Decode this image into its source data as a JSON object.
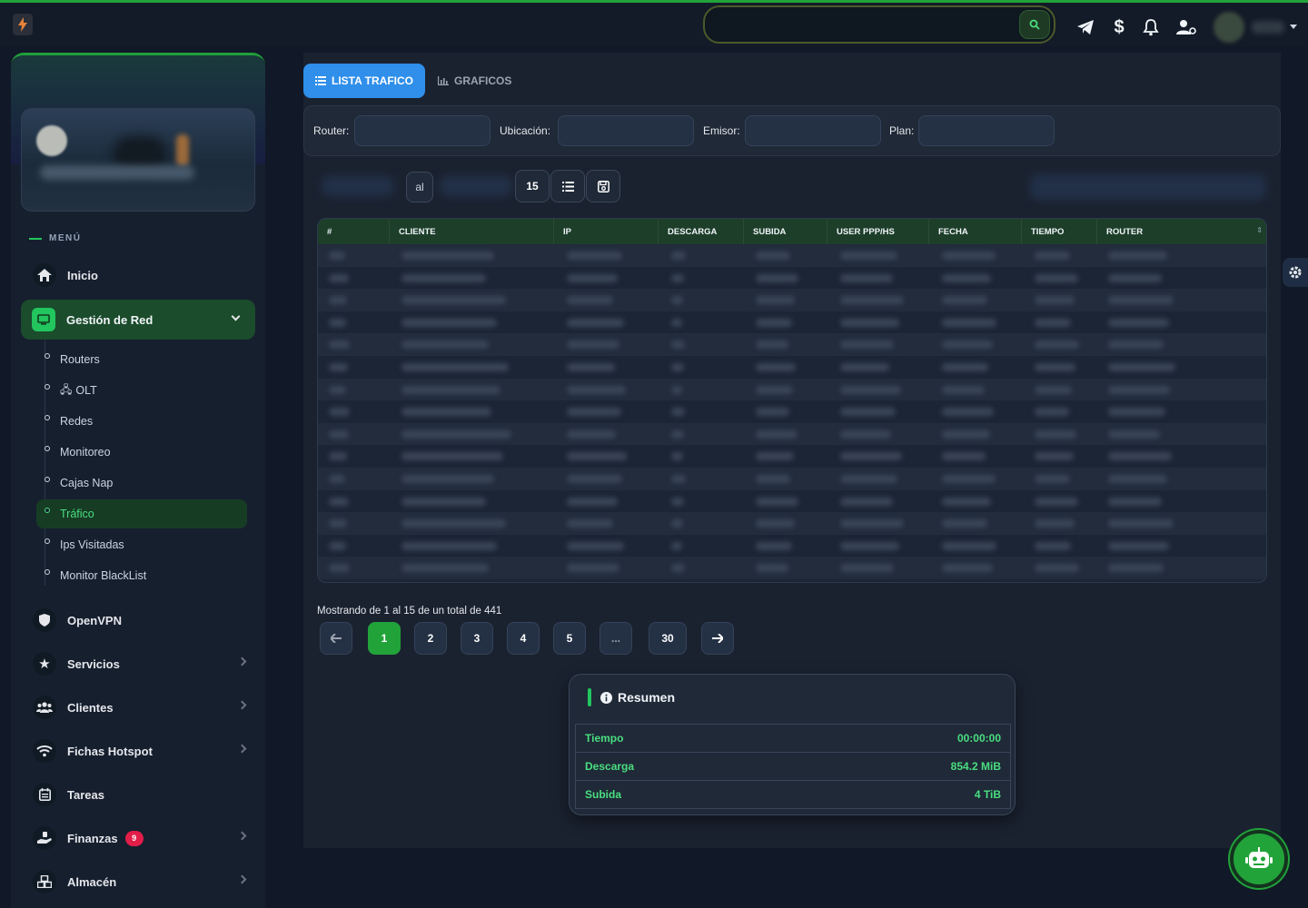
{
  "colors": {
    "accent_green": "#22a33a",
    "tab_blue": "#2f8fea",
    "bg": "#111827",
    "badge_red": "#e11d48"
  },
  "topbar": {
    "icons": [
      "search-icon",
      "telegram-icon",
      "dollar-icon",
      "bell-icon",
      "user-cog-icon"
    ]
  },
  "sidebar": {
    "menu_title": "MENÚ",
    "items": [
      {
        "label": "Inicio",
        "icon": "home-icon"
      },
      {
        "label": "Gestión de Red",
        "icon": "network-icon",
        "expanded": true
      },
      {
        "label": "OpenVPN",
        "icon": "shield-icon"
      },
      {
        "label": "Servicios",
        "icon": "star-icon"
      },
      {
        "label": "Clientes",
        "icon": "users-icon"
      },
      {
        "label": "Fichas Hotspot",
        "icon": "wifi-icon"
      },
      {
        "label": "Tareas",
        "icon": "calendar-icon"
      },
      {
        "label": "Finanzas",
        "icon": "hand-money-icon",
        "badge": "9"
      },
      {
        "label": "Almacén",
        "icon": "boxes-icon"
      }
    ],
    "sub_items": [
      {
        "label": "Routers"
      },
      {
        "label": "OLT"
      },
      {
        "label": "Redes"
      },
      {
        "label": "Monitoreo"
      },
      {
        "label": "Cajas Nap"
      },
      {
        "label": "Tráfico",
        "active": true
      },
      {
        "label": "Ips Visitadas"
      },
      {
        "label": "Monitor BlackList"
      }
    ]
  },
  "tabs": {
    "active": "LISTA TRAFICO",
    "other": "GRAFICOS"
  },
  "filters": {
    "router_label": "Router:",
    "ubicacion_label": "Ubicación:",
    "emisor_label": "Emisor:",
    "plan_label": "Plan:"
  },
  "toolbar": {
    "al_label": "al",
    "page_size": "15"
  },
  "table": {
    "columns": [
      "#",
      "CLIENTE",
      "IP",
      "DESCARGA",
      "SUBIDA",
      "USER PPP/HS",
      "FECHA",
      "TIEMPO",
      "ROUTER"
    ],
    "row_count": 15
  },
  "pagination": {
    "info": "Mostrando de 1 al 15 de un total de 441",
    "pages": [
      "1",
      "2",
      "3",
      "4",
      "5",
      "...",
      "30"
    ],
    "current": "1"
  },
  "resumen": {
    "title": "Resumen",
    "rows": [
      {
        "label": "Tiempo",
        "value": "00:00:00"
      },
      {
        "label": "Descarga",
        "value": "854.2 MiB"
      },
      {
        "label": "Subida",
        "value": "4 TiB"
      }
    ]
  }
}
